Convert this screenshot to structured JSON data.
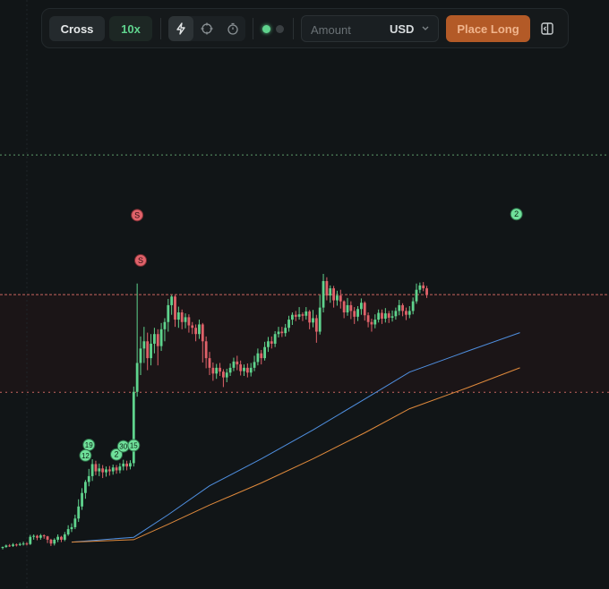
{
  "toolbar": {
    "margin_mode": "Cross",
    "leverage": "10x",
    "mode_icons": [
      "lightning-icon",
      "crosshair-icon",
      "timer-icon"
    ],
    "status_dots": [
      "connected-dot",
      "inactive-dot"
    ],
    "amount": {
      "placeholder": "Amount",
      "value": ""
    },
    "currency": "USD",
    "place_label": "Place Long",
    "panel_icon": "sidebar-panel-icon"
  },
  "colors": {
    "up": "#5fd38d",
    "down": "#e0626a",
    "accent_orange": "#b35a27",
    "ma_fast": "#4f8fe0",
    "ma_slow": "#e08a3c",
    "band_fill": "#1b1517",
    "target_line": "#5e9c6a",
    "band_line": "#c96660"
  },
  "chart_data": {
    "type": "candlestick",
    "title": "",
    "xlabel": "",
    "ylabel": "",
    "y_range": [
      0,
      100
    ],
    "grid": false,
    "horizontal_lines": [
      {
        "name": "target",
        "y": 82.7,
        "style": "dotted-green"
      },
      {
        "name": "entry",
        "y": 53.7,
        "style": "dotted-red"
      },
      {
        "name": "stop",
        "y": 33.4,
        "style": "dotted-red"
      }
    ],
    "candles": [
      [
        1.1,
        1.3,
        0.8,
        1.4
      ],
      [
        1.3,
        1.6,
        1.1,
        1.8
      ],
      [
        1.6,
        1.5,
        1.3,
        1.9
      ],
      [
        1.5,
        1.8,
        1.3,
        2.1
      ],
      [
        1.8,
        1.7,
        1.4,
        2.0
      ],
      [
        1.7,
        1.9,
        1.5,
        2.2
      ],
      [
        1.9,
        2.0,
        1.6,
        2.4
      ],
      [
        2.0,
        1.9,
        1.6,
        2.3
      ],
      [
        1.9,
        3.4,
        1.7,
        3.8
      ],
      [
        3.4,
        3.6,
        2.8,
        3.9
      ],
      [
        3.6,
        3.2,
        2.7,
        3.8
      ],
      [
        3.2,
        3.7,
        2.8,
        4.0
      ],
      [
        3.7,
        3.5,
        3.0,
        3.9
      ],
      [
        3.5,
        2.8,
        2.1,
        3.6
      ],
      [
        2.8,
        2.0,
        1.5,
        3.0
      ],
      [
        2.0,
        2.8,
        1.6,
        3.1
      ],
      [
        2.8,
        3.4,
        2.3,
        3.9
      ],
      [
        3.4,
        2.8,
        2.3,
        3.6
      ],
      [
        2.8,
        3.9,
        2.5,
        4.4
      ],
      [
        3.9,
        5.0,
        3.6,
        5.8
      ],
      [
        5.0,
        5.4,
        4.4,
        6.2
      ],
      [
        5.4,
        7.2,
        5.0,
        8.0
      ],
      [
        7.2,
        9.7,
        6.5,
        11.2
      ],
      [
        9.7,
        12.5,
        9.0,
        13.5
      ],
      [
        12.5,
        14.8,
        11.3,
        15.2
      ],
      [
        14.8,
        16.0,
        13.9,
        17.5
      ],
      [
        16.0,
        18.5,
        15.0,
        19.5
      ],
      [
        18.5,
        17.0,
        16.2,
        19.2
      ],
      [
        17.0,
        17.6,
        16.0,
        18.6
      ],
      [
        17.6,
        16.8,
        15.6,
        18.3
      ],
      [
        16.8,
        17.4,
        15.9,
        18.0
      ],
      [
        17.4,
        17.0,
        16.1,
        18.1
      ],
      [
        17.0,
        17.8,
        16.3,
        18.4
      ],
      [
        17.8,
        17.2,
        16.5,
        18.3
      ],
      [
        17.2,
        18.0,
        16.6,
        18.7
      ],
      [
        18.0,
        18.6,
        17.2,
        19.4
      ],
      [
        18.6,
        18.0,
        17.2,
        19.2
      ],
      [
        18.0,
        18.7,
        17.4,
        19.3
      ],
      [
        18.7,
        33.5,
        18.0,
        34.6
      ],
      [
        33.5,
        39.5,
        32.5,
        56.0
      ],
      [
        39.5,
        42.5,
        37.0,
        45.0
      ],
      [
        42.5,
        44.0,
        39.5,
        47.0
      ],
      [
        44.0,
        40.5,
        38.0,
        45.8
      ],
      [
        40.5,
        43.5,
        39.0,
        45.5
      ],
      [
        43.5,
        45.5,
        41.5,
        46.8
      ],
      [
        45.5,
        43.0,
        39.0,
        46.5
      ],
      [
        43.0,
        46.5,
        42.0,
        47.8
      ],
      [
        46.5,
        48.0,
        44.0,
        48.8
      ],
      [
        48.0,
        51.5,
        46.0,
        52.8
      ],
      [
        51.5,
        53.3,
        49.5,
        53.6
      ],
      [
        53.3,
        48.5,
        47.0,
        53.6
      ],
      [
        48.5,
        50.0,
        46.8,
        51.2
      ],
      [
        50.0,
        48.0,
        46.5,
        50.6
      ],
      [
        48.0,
        49.0,
        46.7,
        49.8
      ],
      [
        49.0,
        47.3,
        45.8,
        49.6
      ],
      [
        47.3,
        46.8,
        45.5,
        48.0
      ],
      [
        46.8,
        45.5,
        44.0,
        47.5
      ],
      [
        45.5,
        47.5,
        44.5,
        48.5
      ],
      [
        47.5,
        44.0,
        39.6,
        47.8
      ],
      [
        44.0,
        40.5,
        38.4,
        45.0
      ],
      [
        40.5,
        38.5,
        37.0,
        41.8
      ],
      [
        38.5,
        37.3,
        35.8,
        39.6
      ],
      [
        37.3,
        38.5,
        36.2,
        39.3
      ],
      [
        38.5,
        37.7,
        36.8,
        39.5
      ],
      [
        37.7,
        36.5,
        34.5,
        38.2
      ],
      [
        36.5,
        37.5,
        35.5,
        38.3
      ],
      [
        37.5,
        38.5,
        36.8,
        39.4
      ],
      [
        38.5,
        39.8,
        37.8,
        40.6
      ],
      [
        39.8,
        39.2,
        38.0,
        41.0
      ],
      [
        39.2,
        37.8,
        36.9,
        40.0
      ],
      [
        37.8,
        38.5,
        36.8,
        39.2
      ],
      [
        38.5,
        37.5,
        36.5,
        39.4
      ],
      [
        37.5,
        38.5,
        36.7,
        39.5
      ],
      [
        38.5,
        39.7,
        37.8,
        41.0
      ],
      [
        39.7,
        41.5,
        39.0,
        42.5
      ],
      [
        41.5,
        40.5,
        39.2,
        42.2
      ],
      [
        40.5,
        42.8,
        40.0,
        43.9
      ],
      [
        42.8,
        44.0,
        41.8,
        44.9
      ],
      [
        44.0,
        43.5,
        42.5,
        45.0
      ],
      [
        43.5,
        45.5,
        42.8,
        46.1
      ],
      [
        45.5,
        46.0,
        44.8,
        47.0
      ],
      [
        46.0,
        45.7,
        44.9,
        47.0
      ],
      [
        45.7,
        46.8,
        45.0,
        47.6
      ],
      [
        46.8,
        48.5,
        46.0,
        49.3
      ],
      [
        48.5,
        49.5,
        47.4,
        50.0
      ],
      [
        49.5,
        49.1,
        48.2,
        50.3
      ],
      [
        49.1,
        49.6,
        48.5,
        51.1
      ],
      [
        49.6,
        49.3,
        48.2,
        50.0
      ],
      [
        49.3,
        50.2,
        48.5,
        51.1
      ],
      [
        50.2,
        47.9,
        46.5,
        50.5
      ],
      [
        47.9,
        48.8,
        46.9,
        50.5
      ],
      [
        48.8,
        46.0,
        43.7,
        49.5
      ],
      [
        46.0,
        51.0,
        45.4,
        53.6
      ],
      [
        51.0,
        56.5,
        50.0,
        58.0
      ],
      [
        56.5,
        53.5,
        52.5,
        57.3
      ],
      [
        53.5,
        55.0,
        52.0,
        55.6
      ],
      [
        55.0,
        52.5,
        51.0,
        55.5
      ],
      [
        52.5,
        53.5,
        51.4,
        54.5
      ],
      [
        53.5,
        52.3,
        50.8,
        54.7
      ],
      [
        52.3,
        50.0,
        48.8,
        52.5
      ],
      [
        50.0,
        51.5,
        49.3,
        53.0
      ],
      [
        51.5,
        50.3,
        48.6,
        52.3
      ],
      [
        50.3,
        49.1,
        47.6,
        51.1
      ],
      [
        49.1,
        50.7,
        48.2,
        51.3
      ],
      [
        50.7,
        52.0,
        49.5,
        52.9
      ],
      [
        52.0,
        49.4,
        48.3,
        52.3
      ],
      [
        49.4,
        48.0,
        46.9,
        50.0
      ],
      [
        48.0,
        47.5,
        46.0,
        48.7
      ],
      [
        47.5,
        48.5,
        46.7,
        49.6
      ],
      [
        48.5,
        49.9,
        47.9,
        50.6
      ],
      [
        49.9,
        48.7,
        47.6,
        50.6
      ],
      [
        48.7,
        49.8,
        47.9,
        50.9
      ],
      [
        49.8,
        48.9,
        47.8,
        50.3
      ],
      [
        48.9,
        49.2,
        48.1,
        50.4
      ],
      [
        49.2,
        50.3,
        48.5,
        51.0
      ],
      [
        50.3,
        51.5,
        49.4,
        52.6
      ],
      [
        51.5,
        50.3,
        49.2,
        51.9
      ],
      [
        50.3,
        49.5,
        48.4,
        51.0
      ],
      [
        49.5,
        50.3,
        48.8,
        51.3
      ],
      [
        50.3,
        52.3,
        49.6,
        53.1
      ],
      [
        52.3,
        54.7,
        51.8,
        56.0
      ],
      [
        54.7,
        55.6,
        54.0,
        56.2
      ],
      [
        55.6,
        55.0,
        54.4,
        56.3
      ],
      [
        55.0,
        53.7,
        53.0,
        55.5
      ]
    ],
    "moving_averages": [
      {
        "name": "MA-fast",
        "color_key": "ma_fast",
        "points": [
          [
            20,
            2.3
          ],
          [
            38,
            3.3
          ],
          [
            48,
            8.0
          ],
          [
            60,
            14.0
          ],
          [
            75,
            19.6
          ],
          [
            90,
            25.6
          ],
          [
            105,
            32.0
          ],
          [
            118,
            37.6
          ],
          [
            135,
            42.0
          ],
          [
            150,
            45.8
          ]
        ]
      },
      {
        "name": "MA-slow",
        "color_key": "ma_slow",
        "points": [
          [
            20,
            2.3
          ],
          [
            38,
            2.8
          ],
          [
            48,
            6.0
          ],
          [
            60,
            10.0
          ],
          [
            75,
            14.6
          ],
          [
            90,
            19.6
          ],
          [
            105,
            25.0
          ],
          [
            118,
            30.0
          ],
          [
            135,
            34.4
          ],
          [
            150,
            38.5
          ]
        ]
      }
    ],
    "markers": [
      {
        "label": "S",
        "kind": "sell",
        "candle": 39,
        "y": 70.2
      },
      {
        "label": "S",
        "kind": "sell",
        "candle": 40,
        "y": 60.8
      },
      {
        "label": "2",
        "kind": "buy",
        "candle": 149,
        "y": 70.4
      },
      {
        "label": "19",
        "kind": "buy",
        "candle": 25,
        "y": 22.5
      },
      {
        "label": "12",
        "kind": "buy",
        "candle": 24,
        "y": 20.3
      },
      {
        "label": "2",
        "kind": "buy",
        "candle": 33,
        "y": 20.5
      },
      {
        "label": "30",
        "kind": "buy",
        "candle": 35,
        "y": 22.2
      },
      {
        "label": "15",
        "kind": "buy",
        "candle": 38,
        "y": 22.4
      }
    ]
  }
}
